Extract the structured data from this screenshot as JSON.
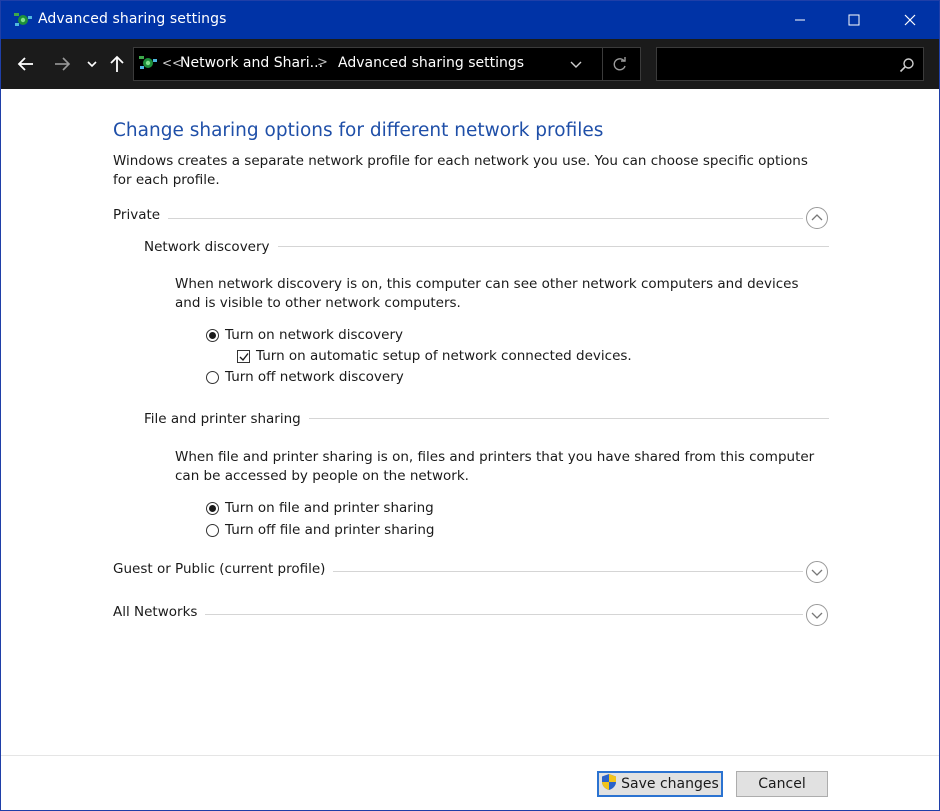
{
  "window": {
    "title": "Advanced sharing settings"
  },
  "address_bar": {
    "overflow_chevron": "<<",
    "crumbs": [
      "Network and Shari...",
      "Advanced sharing settings"
    ],
    "separator": ">"
  },
  "search": {
    "value": "",
    "placeholder": ""
  },
  "main": {
    "heading": "Change sharing options for different network profiles",
    "intro": "Windows creates a separate network profile for each network you use. You can choose specific options for each profile.",
    "profiles": {
      "private": {
        "label": "Private",
        "expanded": true,
        "network_discovery": {
          "label": "Network discovery",
          "description": "When network discovery is on, this computer can see other network computers and devices and is visible to other network computers.",
          "turn_on": "Turn on network discovery",
          "auto_setup": "Turn on automatic setup of network connected devices.",
          "turn_off": "Turn off network discovery",
          "selected": "on",
          "auto_setup_checked": true
        },
        "file_printer_sharing": {
          "label": "File and printer sharing",
          "description": "When file and printer sharing is on, files and printers that you have shared from this computer can be accessed by people on the network.",
          "turn_on": "Turn on file and printer sharing",
          "turn_off": "Turn off file and printer sharing",
          "selected": "on"
        }
      },
      "guest_public": {
        "label": "Guest or Public (current profile)",
        "expanded": false
      },
      "all_networks": {
        "label": "All Networks",
        "expanded": false
      }
    }
  },
  "footer": {
    "save_label": "Save changes",
    "cancel_label": "Cancel"
  },
  "colors": {
    "titlebar": "#0033a6",
    "heading": "#1f4fa8",
    "navbar": "#1b1b1b"
  }
}
